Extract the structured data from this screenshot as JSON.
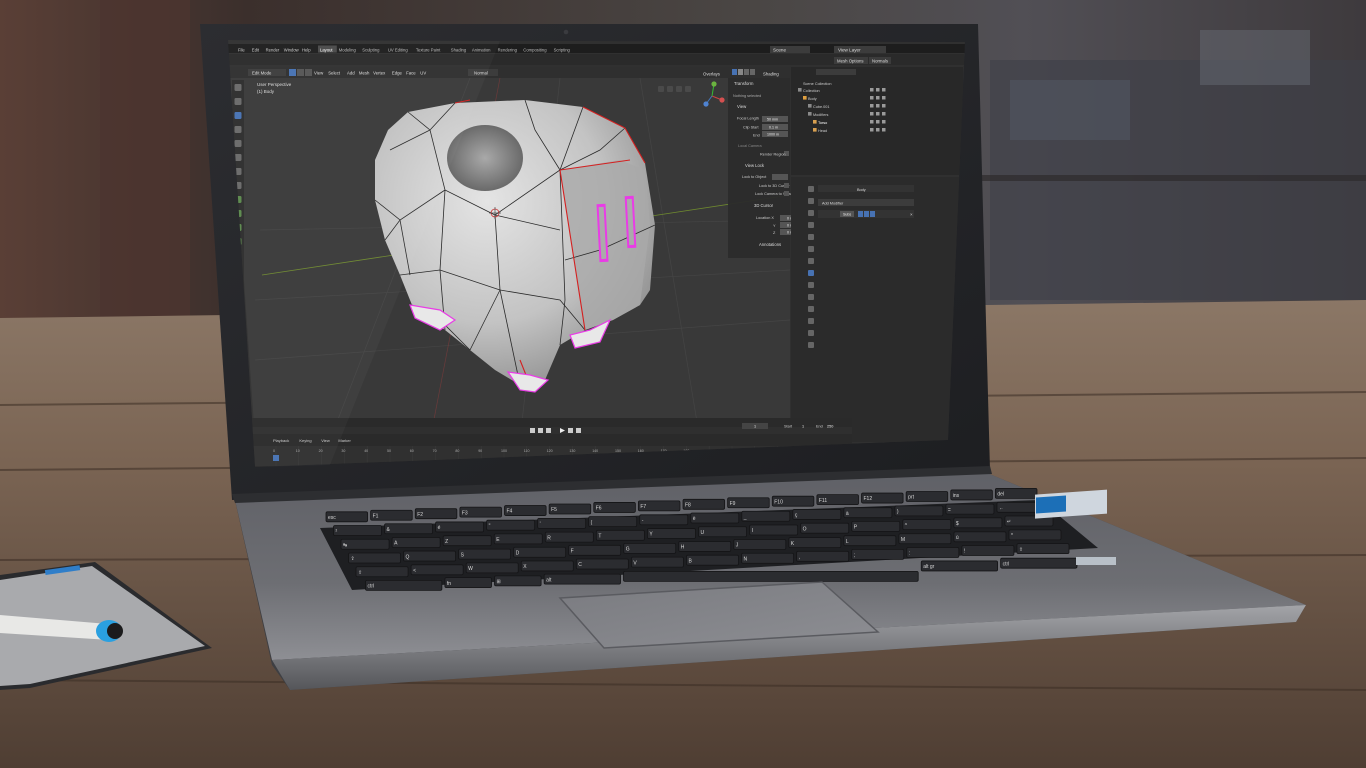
{
  "menu": [
    "File",
    "Edit",
    "Render",
    "Window",
    "Help"
  ],
  "workspace_tabs": [
    "Layout",
    "Modeling",
    "Sculpting",
    "UV Editing",
    "Texture Paint",
    "Shading",
    "Animation",
    "Rendering",
    "Compositing",
    "Scripting"
  ],
  "scene": {
    "name": "Scene",
    "view_layer": "View Layer"
  },
  "header": {
    "mode": "Edit Mode",
    "menus": [
      "View",
      "Select",
      "Add",
      "Mesh",
      "Vertex",
      "Edge",
      "Face",
      "UV"
    ],
    "orientation": "Normal",
    "overlays": "Overlays",
    "shading": "Shading"
  },
  "viewport": {
    "persp_label": "User Perspective",
    "object_label": "(1) Body"
  },
  "npanel": {
    "transform": "Transform",
    "nothing_selected": "Nothing selected",
    "view": "View",
    "focal_label": "Focal Length",
    "focal_value": "50 mm",
    "clip_start_label": "Clip Start",
    "clip_start_value": "0.1 m",
    "clip_end_label": "End",
    "clip_end_value": "1000 m",
    "local_camera": "Local Camera",
    "render_region": "Render Region",
    "view_lock": "View Lock",
    "lock_to_object": "Lock to Object",
    "lock_to_cursor": "Lock to 3D Cursor",
    "lock_camera": "Lock Camera to View",
    "cursor_3d": "3D Cursor",
    "location_x": "Location X",
    "y_label": "Y",
    "z_label": "Z",
    "loc_x_value": "0 m",
    "loc_y_value": "0 m",
    "loc_z_value": "0 m",
    "annotations": "Annotations"
  },
  "outliner": {
    "title": "Scene Collection",
    "items": [
      "Collection",
      "Body",
      "Cube.001",
      "Modifiers",
      "Torso",
      "Head"
    ]
  },
  "properties": {
    "object": "Body",
    "add_modifier": "Add Modifier",
    "modifier_name": "Subs"
  },
  "header_buttons": {
    "mesh_options": "Mesh Options",
    "normals": "Normals"
  },
  "timeline": {
    "menus": [
      "Playback",
      "Keying",
      "View",
      "Marker"
    ],
    "current_frame": "1",
    "start_label": "Start",
    "start_value": "1",
    "end_label": "End",
    "end_value": "250",
    "ticks": [
      "0",
      "10",
      "20",
      "30",
      "40",
      "50",
      "60",
      "70",
      "80",
      "90",
      "100",
      "110",
      "120",
      "130",
      "140",
      "150",
      "160",
      "170",
      "180",
      "190",
      "200",
      "210",
      "220",
      "230",
      "240",
      "250"
    ]
  },
  "colors": {
    "ui_dark": "#262626",
    "ui_panel": "#303030",
    "viewport_bg": "#393939",
    "accent": "#4772b3",
    "mesh": "#c9c9c9",
    "seam_edge": "#d42020",
    "selected_face": "#e93ce6",
    "table_wood": "#6f5a48",
    "laptop_body": "#4a4b4f"
  },
  "keyboard": {
    "rows": [
      [
        "esc",
        "F1",
        "F2",
        "F3",
        "F4",
        "F5",
        "F6",
        "F7",
        "F8",
        "F9",
        "F10",
        "F11",
        "F12",
        "prt",
        "ins",
        "del"
      ],
      [
        "²",
        "&",
        "é",
        "\"",
        "'",
        "(",
        "-",
        "è",
        "_",
        "ç",
        "à",
        ")",
        "=",
        "←"
      ],
      [
        "↹",
        "A",
        "Z",
        "E",
        "R",
        "T",
        "Y",
        "U",
        "I",
        "O",
        "P",
        "^",
        "$",
        "↵"
      ],
      [
        "⇪",
        "Q",
        "S",
        "D",
        "F",
        "G",
        "H",
        "J",
        "K",
        "L",
        "M",
        "ù",
        "*"
      ],
      [
        "⇧",
        "<",
        "W",
        "X",
        "C",
        "V",
        "B",
        "N",
        ",",
        ";",
        ":",
        "!",
        "⇧"
      ],
      [
        "ctrl",
        "fn",
        "⊞",
        "alt",
        "",
        "alt gr",
        "ctrl"
      ]
    ]
  }
}
